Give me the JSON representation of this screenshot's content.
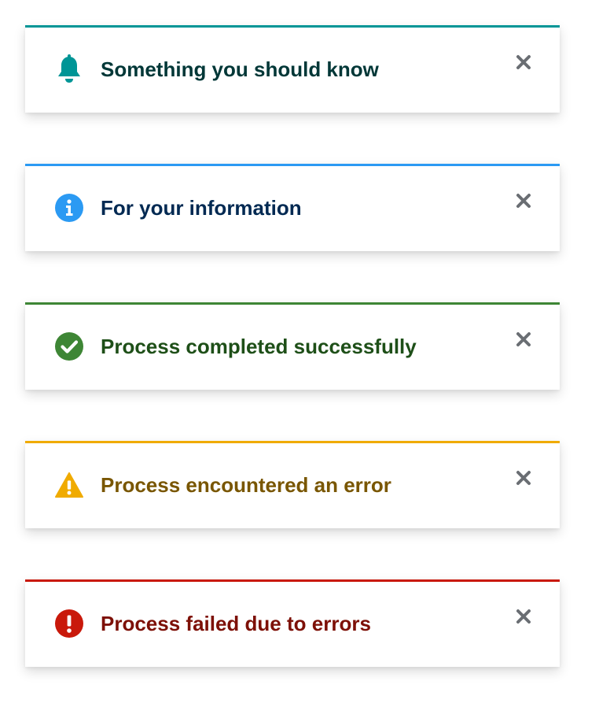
{
  "alerts": [
    {
      "variant": "default",
      "title": "Something you should know",
      "icon": "bell-icon",
      "color": "#009596",
      "title_color": "#003737"
    },
    {
      "variant": "info",
      "title": "For your information",
      "icon": "info-circle-icon",
      "color": "#2b9af3",
      "title_color": "#002952"
    },
    {
      "variant": "success",
      "title": "Process completed successfully",
      "icon": "check-circle-icon",
      "color": "#3e8635",
      "title_color": "#1e4f18"
    },
    {
      "variant": "warning",
      "title": "Process encountered an error",
      "icon": "warning-triangle-icon",
      "color": "#f0ab00",
      "title_color": "#795600"
    },
    {
      "variant": "danger",
      "title": "Process failed due to errors",
      "icon": "exclamation-circle-icon",
      "color": "#c9190b",
      "title_color": "#7d1007"
    }
  ],
  "close_icon": "close-icon",
  "close_icon_color": "#6a6e73"
}
